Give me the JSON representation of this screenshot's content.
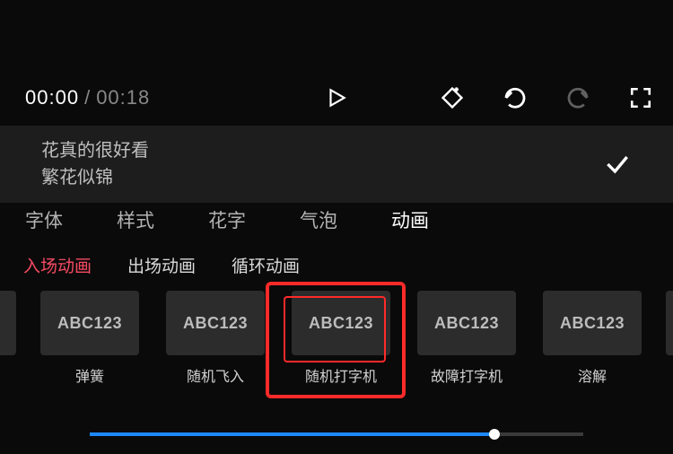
{
  "playback": {
    "current_time": "00:00",
    "separator": "/",
    "total_time": "00:18"
  },
  "text_preview": {
    "line1": "花真的很好看",
    "line2": "繁花似锦"
  },
  "tabs": {
    "font": "字体",
    "style": "样式",
    "flower_text": "花字",
    "bubble": "气泡",
    "animation": "动画"
  },
  "subtabs": {
    "enter": "入场动画",
    "exit": "出场动画",
    "loop": "循环动画"
  },
  "thumbs": {
    "sample": "ABC123",
    "spring": "弹簧",
    "random_fly": "随机飞入",
    "random_typewriter": "随机打字机",
    "glitch_typewriter": "故障打字机",
    "dissolve": "溶解"
  },
  "slider": {
    "percent": 82
  },
  "colors": {
    "accent_red": "#f44a62",
    "highlight": "#ff2a2a",
    "slider_blue": "#1e88ff"
  }
}
